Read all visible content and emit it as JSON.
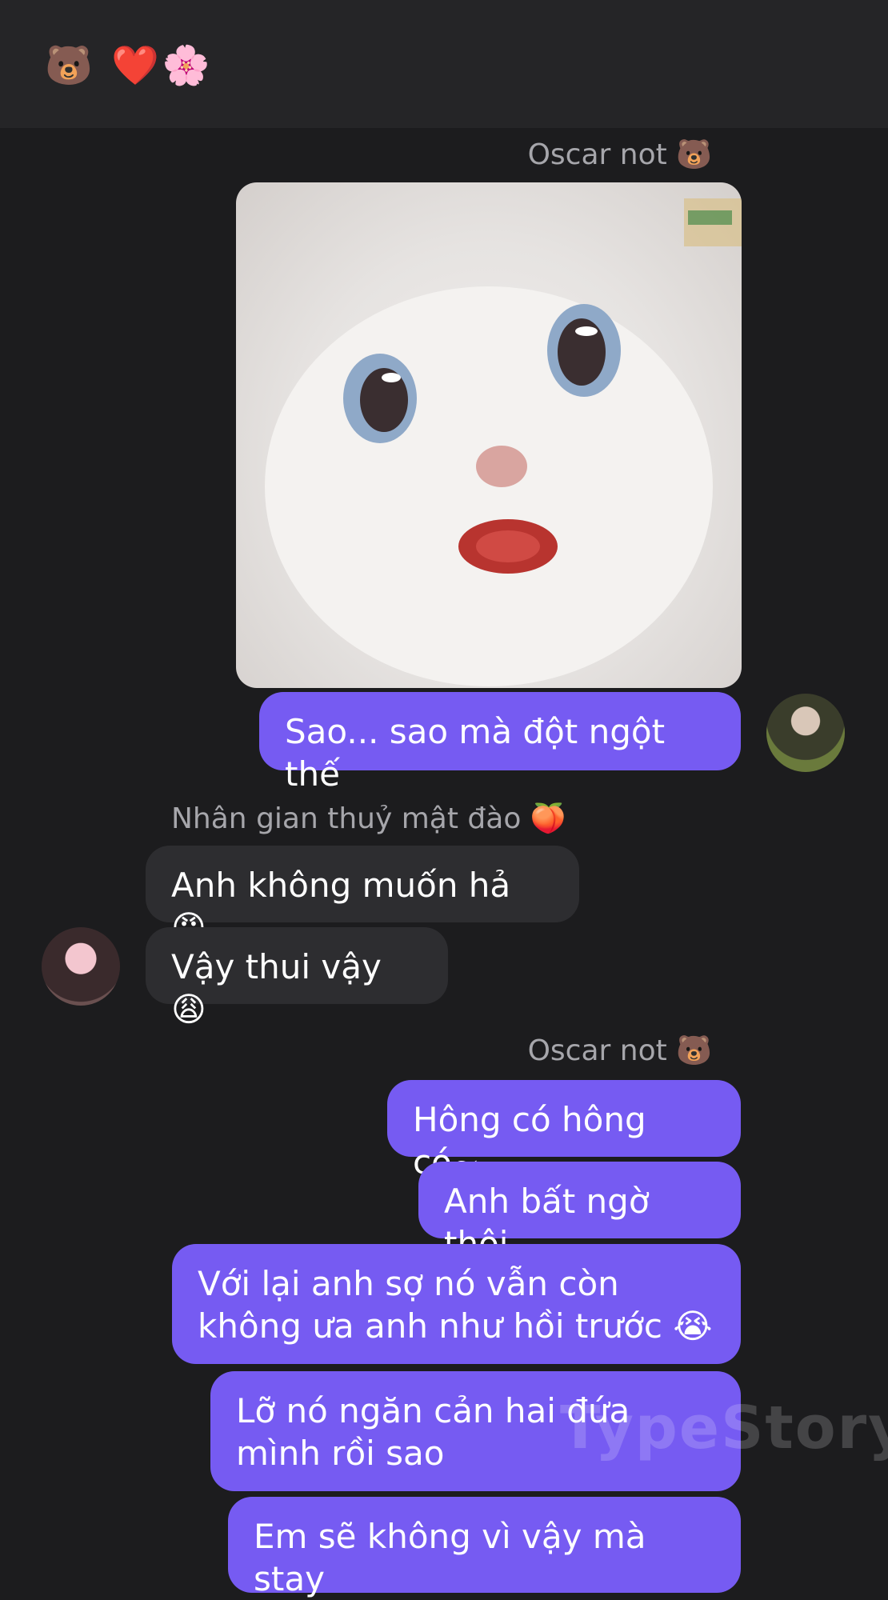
{
  "header": {
    "emojis": "🐻 ❤️🌸"
  },
  "messages": {
    "sender_oscar_1": "Oscar not 🐻",
    "oscar_text_1": "Sao... sao mà đột ngột thế",
    "sender_nhan": "Nhân gian thuỷ mật đào 🍑",
    "nhan_text_1": "Anh không muốn hả 😠",
    "nhan_text_2": "Vậy thui vậy 😩",
    "sender_oscar_2": "Oscar not 🐻",
    "oscar_text_2": "Hông có hông có~",
    "oscar_text_3": "Anh bất ngờ thôi",
    "oscar_text_4": "Với lại anh sợ nó vẫn còn không ưa anh như hồi trước 😭",
    "oscar_text_5": "Lỡ nó ngăn cản hai đứa mình rồi sao",
    "oscar_text_6": "Em sẽ không vì vậy mà stay"
  },
  "watermark": "TypeStory"
}
